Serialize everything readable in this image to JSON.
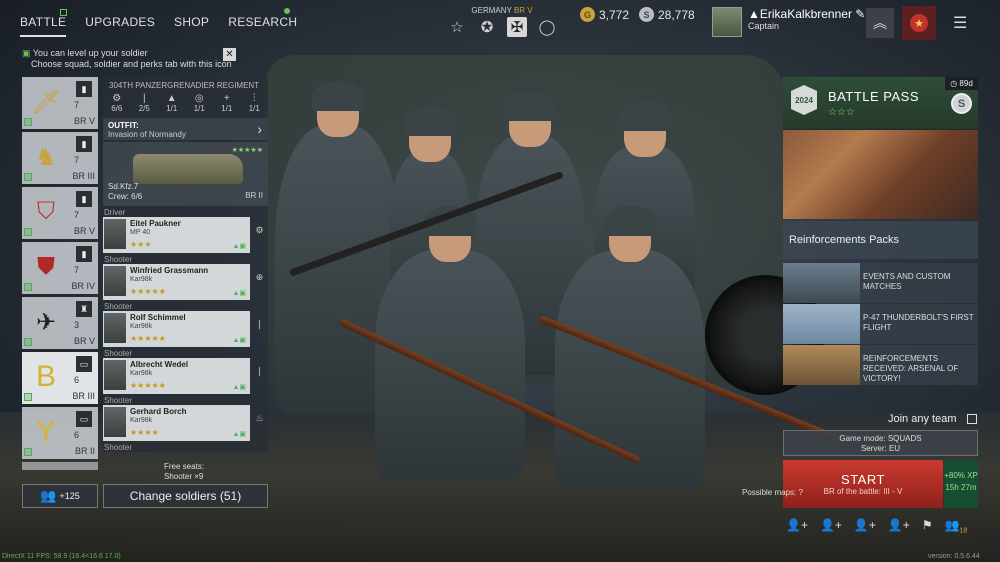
{
  "nav": {
    "tabs": [
      {
        "label": "BATTLE",
        "active": true
      },
      {
        "label": "UPGRADES"
      },
      {
        "label": "SHOP"
      },
      {
        "label": "RESEARCH"
      }
    ]
  },
  "nation": {
    "name": "GERMANY",
    "br": "BR V"
  },
  "currency": {
    "gold": "3,772",
    "silver": "28,778"
  },
  "profile": {
    "name": "ErikaKalkbrenner",
    "rank": "Captain"
  },
  "hint": {
    "line1": "You can level up your soldier",
    "line2": "Choose squad, soldier and perks tab with this icon"
  },
  "squads": [
    {
      "count": "7",
      "br": "BR V"
    },
    {
      "count": "7",
      "br": "BR III"
    },
    {
      "count": "7",
      "br": "BR V"
    },
    {
      "count": "7",
      "br": "BR IV"
    },
    {
      "count": "3",
      "br": "BR V"
    },
    {
      "count": "6",
      "br": "BR III"
    },
    {
      "count": "6",
      "br": "BR II"
    }
  ],
  "detail": {
    "regiment": "304TH PANZERGRENADIER REGIMENT",
    "perks": [
      {
        "icon": "⚙",
        "value": "6/6"
      },
      {
        "icon": "|",
        "value": "2/5"
      },
      {
        "icon": "▲",
        "value": "1/1"
      },
      {
        "icon": "◎",
        "value": "1/1"
      },
      {
        "icon": "+",
        "value": "1/1"
      },
      {
        "icon": "⫶",
        "value": "1/1"
      }
    ],
    "outfit_label": "OUTFIT:",
    "outfit_value": "Invasion of Normandy",
    "vehicle": {
      "name": "Sd.Kfz.7",
      "crew": "Crew: 6/6",
      "br": "BR II",
      "stars": "★★★★★"
    },
    "soldiers": [
      {
        "role": "Driver",
        "name": "Eitel Paukner",
        "weapon": "MP 40",
        "stars": "★★★"
      },
      {
        "role": "Shooter",
        "name": "Winfried Grassmann",
        "weapon": "Kar98k",
        "stars": "★★★★★"
      },
      {
        "role": "Shooter",
        "name": "Rolf Schimmel",
        "weapon": "Kar98k",
        "stars": "★★★★★"
      },
      {
        "role": "Shooter",
        "name": "Albrecht Wedel",
        "weapon": "Kar98k",
        "stars": "★★★★★"
      },
      {
        "role": "Shooter",
        "name": "Gerhard Borch",
        "weapon": "Kar98k",
        "stars": "★★★★"
      }
    ],
    "last_role": "Shooter",
    "free_seats_label": "Free seats:",
    "free_seats_value": "Shooter ×9"
  },
  "buttons": {
    "reserve_count": "+125",
    "change_soldiers": "Change soldiers (51)"
  },
  "battle_pass": {
    "title": "BATTLE PASS",
    "stars": "☆☆☆",
    "days": "89d",
    "logo": "2024"
  },
  "reinforcements": {
    "title": "Reinforcements Packs"
  },
  "news": [
    {
      "text": "EVENTS AND CUSTOM MATCHES"
    },
    {
      "text": "P-47 THUNDERBOLT'S FIRST FLIGHT"
    },
    {
      "text": "REINFORCEMENTS RECEIVED: ARSENAL OF VICTORY!"
    }
  ],
  "join_team": "Join any team",
  "game_mode": {
    "mode": "Game mode: SQUADS",
    "server": "Server: EU"
  },
  "start": {
    "label": "START",
    "br": "BR of the battle: III - V",
    "xp": "+80% XP",
    "time": "15h 27m"
  },
  "possible_maps": "Possible maps:",
  "friends_count": "18",
  "fps": "DirectX 11 FPS: 58.9 (16.4<16.6 17.0)",
  "version": "version: 0.5.6.44"
}
